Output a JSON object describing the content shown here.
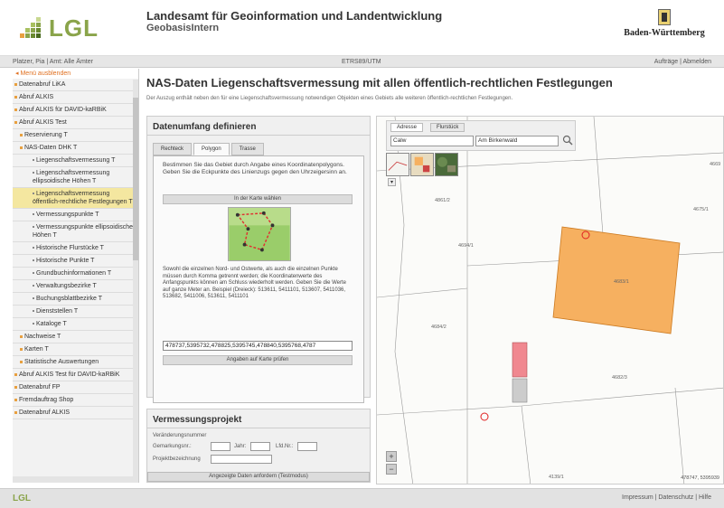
{
  "header": {
    "logo_text": "LGL",
    "title": "Landesamt für Geoinformation und Landentwicklung",
    "subtitle": "GeobasisIntern",
    "state_name": "Baden-Württemberg"
  },
  "userbar": {
    "user": "Platzer, Pia | Amt: Alle Ämter",
    "projection": "ETRS89/UTM",
    "links": "Aufträge | Abmelden"
  },
  "sidebar": {
    "hide_label": "Menü ausblenden",
    "items": [
      {
        "label": "Datenabruf LiKA",
        "level": 0
      },
      {
        "label": "Abruf ALKIS",
        "level": 0
      },
      {
        "label": "Abruf ALKIS für DAVID-kaRBiK",
        "level": 0
      },
      {
        "label": "Abruf ALKIS Test",
        "level": 0
      },
      {
        "label": "Reservierung T",
        "level": 1
      },
      {
        "label": "NAS-Daten DHK T",
        "level": 1
      },
      {
        "label": "Liegenschaftsvermessung T",
        "level": 3
      },
      {
        "label": "Liegenschaftsvermessung ellipsoidische Höhen T",
        "level": 3
      },
      {
        "label": "Liegenschaftsvermessung öffentlich-rechtliche Festlegungen T",
        "level": 3,
        "active": true
      },
      {
        "label": "Vermessungspunkte T",
        "level": 3
      },
      {
        "label": "Vermessungspunkte ellipsoidische Höhen T",
        "level": 3
      },
      {
        "label": "Historische Flurstücke T",
        "level": 3
      },
      {
        "label": "Historische Punkte T",
        "level": 3
      },
      {
        "label": "Grundbuchinformationen T",
        "level": 3
      },
      {
        "label": "Verwaltungsbezirke T",
        "level": 3
      },
      {
        "label": "Buchungsblattbezirke T",
        "level": 3
      },
      {
        "label": "Dienststellen T",
        "level": 3
      },
      {
        "label": "Kataloge T",
        "level": 3
      },
      {
        "label": "Nachweise T",
        "level": 1
      },
      {
        "label": "Karten T",
        "level": 1
      },
      {
        "label": "Statistische Auswertungen",
        "level": 1
      },
      {
        "label": "Abruf ALKIS Test für DAVID-kaRBiK",
        "level": 0
      },
      {
        "label": "Datenabruf FP",
        "level": 0
      },
      {
        "label": "Fremdauftrag Shop",
        "level": 0
      },
      {
        "label": "Datenabruf ALKIS",
        "level": 0
      }
    ]
  },
  "main": {
    "title": "NAS-Daten Liegenschaftsvermessung mit allen öffentlich-rechtlichen Festlegungen",
    "description": "Der Auszug enthält neben den für eine Liegenschaftsvermessung notwendigen Objekten eines Gebiets alle weiteren öffentlich-rechtlichen Festlegungen."
  },
  "panel1": {
    "title": "Datenumfang definieren",
    "tabs": [
      "Rechteck",
      "Polygon",
      "Trasse"
    ],
    "instruction": "Bestimmen Sie das Gebiet durch Angabe eines Koordinatenpolygons. Geben Sie die Eckpunkte des Linienzugs gegen den Uhrzeigersinn an.",
    "btn_map": "In der Karte wählen",
    "instruction2": "Sowohl die einzelnen Nord- und Ostwerte, als auch die einzelnen Punkte müssen durch Komma getrennt werden; die Koordinatenwerte des Anfangspunkts können am Schluss wiederholt werden. Geben Sie die Werte auf ganze Meter an. Beispiel (Dreieck): 513611, 5411101, 513607, 5411036, 513682, 5411006, 513611, 5411101",
    "coords_value": "478737,5395732,478825,5395745,478840,5395768,4787",
    "btn_check": "Angaben auf Karte prüfen"
  },
  "panel2": {
    "title": "Vermessungsprojekt",
    "label_change": "Veränderungsnummer",
    "label_gemarkung": "Gemarkungsnr.:",
    "label_jahr": "Jahr:",
    "label_lfd": "Lfd.Nr.:",
    "label_proj": "Projektbezeichnung",
    "btn_request": "Angezeigte Daten anfordern (Testmodus)"
  },
  "map": {
    "tabs": [
      "Adresse",
      "Flurstück"
    ],
    "city_value": "Calw",
    "street_value": "Am Birkenwald",
    "layer_label": "▾",
    "labels": {
      "a": "4861/2",
      "b": "4675/1",
      "c": "4694/1",
      "d": "4684/2",
      "e": "4683/1",
      "f": "4682/3",
      "g": "4681/1",
      "h": "4139/1",
      "i": "4669"
    },
    "coords": "478747, 5395939",
    "zoom_in": "+",
    "zoom_out": "−"
  },
  "footer": {
    "logo": "LGL",
    "links": "Impressum | Datenschutz | Hilfe"
  },
  "colors": {
    "brand": "#8aa44a",
    "parcel": "#f6b060",
    "highlight": "#f4e7a0"
  }
}
